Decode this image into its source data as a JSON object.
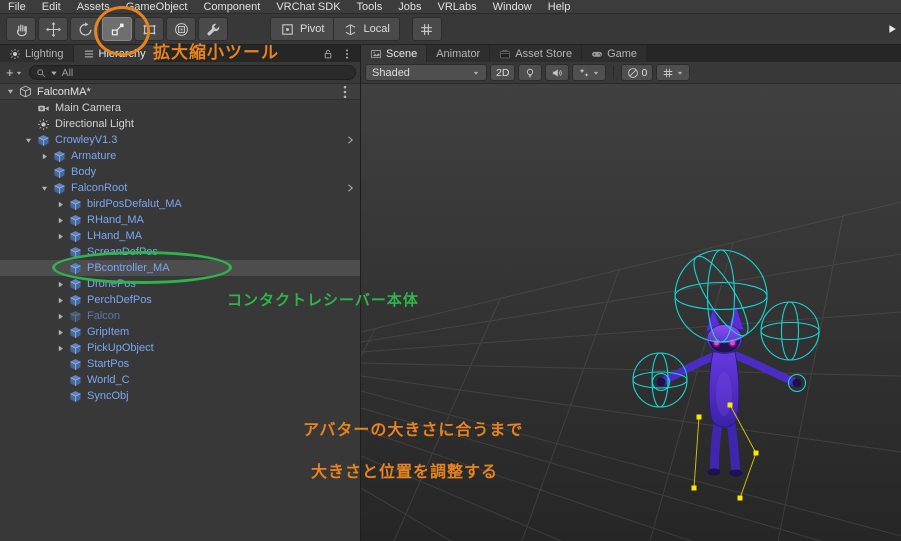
{
  "colors": {
    "annotation_orange": "#e8831d",
    "annotation_green": "#2fb44c",
    "prefab_text_blue": "#7aa7f5",
    "selection_gray": "#4d4d4d"
  },
  "menu_bar": [
    "File",
    "Edit",
    "Assets",
    "GameObject",
    "Component",
    "VRChat SDK",
    "Tools",
    "Jobs",
    "VRLabs",
    "Window",
    "Help"
  ],
  "toolbar": {
    "tools": [
      {
        "id": "hand-tool",
        "icon": "hand-icon",
        "selected": false
      },
      {
        "id": "move-tool",
        "icon": "move-icon",
        "selected": false
      },
      {
        "id": "rotate-tool",
        "icon": "rotate-icon",
        "selected": false
      },
      {
        "id": "scale-tool",
        "icon": "scale-icon",
        "selected": true
      },
      {
        "id": "rect-tool",
        "icon": "rect-icon",
        "selected": false
      },
      {
        "id": "transform-tool",
        "icon": "transform-icon",
        "selected": false
      },
      {
        "id": "custom-tool",
        "icon": "wrench-icon",
        "selected": false
      }
    ],
    "pivot_label": "Pivot",
    "local_label": "Local"
  },
  "hierarchy": {
    "tabs": [
      {
        "label": "Lighting",
        "icon": "lighting-icon",
        "active": false
      },
      {
        "label": "Hierarchy",
        "icon": "hierarchy-icon",
        "active": true
      }
    ],
    "create_label": "+",
    "search_value": "All",
    "scene_row": {
      "name": "FalconMA*"
    },
    "items": [
      {
        "name": "Main Camera",
        "level": 1,
        "icon": "camera-icon",
        "expand": "none",
        "blue": false,
        "disabled": false,
        "selected": false,
        "chevron": false
      },
      {
        "name": "Directional Light",
        "level": 1,
        "icon": "light-icon",
        "expand": "none",
        "blue": false,
        "disabled": false,
        "selected": false,
        "chevron": false
      },
      {
        "name": "CrowleyV1.3",
        "level": 1,
        "icon": "prefab-cube-icon",
        "expand": "open",
        "blue": true,
        "disabled": false,
        "selected": false,
        "chevron": true
      },
      {
        "name": "Armature",
        "level": 2,
        "icon": "prefab-cube-icon",
        "expand": "closed",
        "blue": true,
        "disabled": false,
        "selected": false,
        "chevron": false
      },
      {
        "name": "Body",
        "level": 2,
        "icon": "prefab-cube-icon",
        "expand": "none",
        "blue": true,
        "disabled": false,
        "selected": false,
        "chevron": false
      },
      {
        "name": "FalconRoot",
        "level": 2,
        "icon": "prefab-cube-icon",
        "expand": "open",
        "blue": true,
        "disabled": false,
        "selected": false,
        "chevron": true
      },
      {
        "name": "birdPosDefalut_MA",
        "level": 3,
        "icon": "prefab-cube-icon",
        "expand": "closed",
        "blue": true,
        "disabled": false,
        "selected": false,
        "chevron": false
      },
      {
        "name": "RHand_MA",
        "level": 3,
        "icon": "prefab-cube-icon",
        "expand": "closed",
        "blue": true,
        "disabled": false,
        "selected": false,
        "chevron": false
      },
      {
        "name": "LHand_MA",
        "level": 3,
        "icon": "prefab-cube-icon",
        "expand": "closed",
        "blue": true,
        "disabled": false,
        "selected": false,
        "chevron": false
      },
      {
        "name": "ScreanDefPos",
        "level": 3,
        "icon": "prefab-cube-icon",
        "expand": "none",
        "blue": true,
        "disabled": false,
        "selected": false,
        "chevron": false
      },
      {
        "name": "PBcontroller_MA",
        "level": 3,
        "icon": "prefab-cube-icon",
        "expand": "none",
        "blue": true,
        "disabled": false,
        "selected": true,
        "chevron": false
      },
      {
        "name": "DronePos",
        "level": 3,
        "icon": "prefab-cube-icon",
        "expand": "closed",
        "blue": true,
        "disabled": false,
        "selected": false,
        "chevron": false
      },
      {
        "name": "PerchDefPos",
        "level": 3,
        "icon": "prefab-cube-icon",
        "expand": "closed",
        "blue": true,
        "disabled": false,
        "selected": false,
        "chevron": false
      },
      {
        "name": "Falcon",
        "level": 3,
        "icon": "prefab-cube-icon",
        "expand": "closed",
        "blue": true,
        "disabled": true,
        "selected": false,
        "chevron": false
      },
      {
        "name": "GripItem",
        "level": 3,
        "icon": "prefab-cube-icon",
        "expand": "closed",
        "blue": true,
        "disabled": false,
        "selected": false,
        "chevron": false
      },
      {
        "name": "PickUpObject",
        "level": 3,
        "icon": "prefab-cube-icon",
        "expand": "closed",
        "blue": true,
        "disabled": false,
        "selected": false,
        "chevron": false
      },
      {
        "name": "StartPos",
        "level": 3,
        "icon": "prefab-cube-icon",
        "expand": "none",
        "blue": true,
        "disabled": false,
        "selected": false,
        "chevron": false
      },
      {
        "name": "World_C",
        "level": 3,
        "icon": "prefab-cube-icon",
        "expand": "none",
        "blue": true,
        "disabled": false,
        "selected": false,
        "chevron": false
      },
      {
        "name": "SyncObj",
        "level": 3,
        "icon": "prefab-cube-icon",
        "expand": "none",
        "blue": true,
        "disabled": false,
        "selected": false,
        "chevron": false
      }
    ]
  },
  "scene_panel": {
    "tabs": [
      {
        "label": "Scene",
        "icon": "scene-tab-icon",
        "active": true
      },
      {
        "label": "Animator",
        "icon": null,
        "active": false
      },
      {
        "label": "Asset Store",
        "icon": "asset-store-icon",
        "active": false
      },
      {
        "label": "Game",
        "icon": "game-icon",
        "active": false
      }
    ],
    "toolbar": {
      "shading": "Shaded",
      "mode_2d": "2D",
      "hidden_count": "0"
    }
  },
  "annotations": {
    "scale_tool_note": "拡大縮小ツール",
    "receiver_note": "コンタクトレシーバー本体",
    "resize_note_line1": "アバターの大きさに合うまで",
    "resize_note_line2": "大きさと位置を調整する"
  }
}
